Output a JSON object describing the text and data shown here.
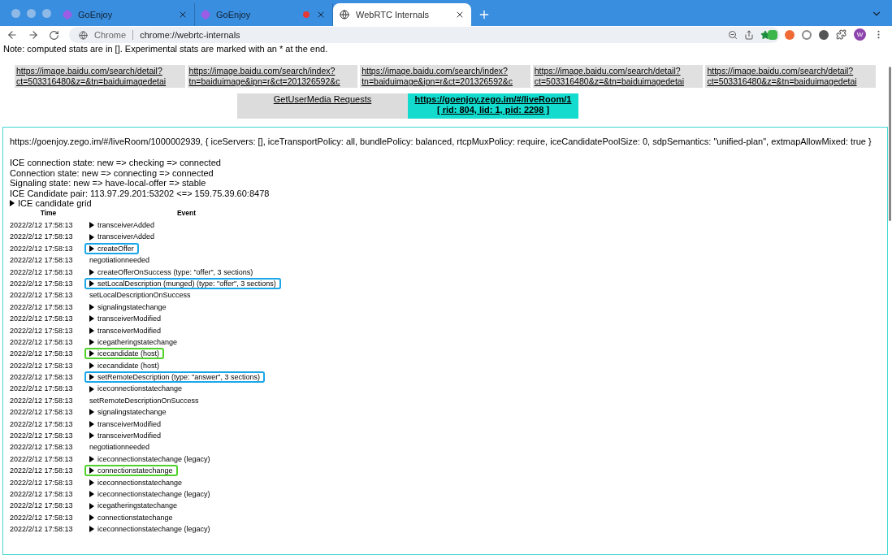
{
  "browser_tabs": [
    {
      "title": "GoEnjoy",
      "selected": false,
      "recording": false
    },
    {
      "title": "GoEnjoy",
      "selected": false,
      "recording": true
    },
    {
      "title": "WebRTC Internals",
      "selected": true,
      "recording": false
    }
  ],
  "address_bar": {
    "site_label": "Chrome",
    "url": "chrome://webrtc-internals"
  },
  "profile_initial": "W",
  "note": "Note: computed stats are in []. Experimental stats are marked with an * at the end.",
  "page_tabs_row1": [
    {
      "lines": [
        "https://image.baidu.com/search/detail?",
        "ct=503316480&z=&tn=baiduimagedetai"
      ]
    },
    {
      "lines": [
        "https://image.baidu.com/search/index?",
        "tn=baiduimage&ipn=r&ct=201326592&c"
      ]
    },
    {
      "lines": [
        "https://image.baidu.com/search/index?",
        "tn=baiduimage&ipn=r&ct=201326592&c"
      ]
    },
    {
      "lines": [
        "https://image.baidu.com/search/detail?",
        "ct=503316480&z=&tn=baiduimagedetai"
      ]
    },
    {
      "lines": [
        "https://image.baidu.com/search/detail?",
        "ct=503316480&z=&tn=baiduimagedetai"
      ]
    }
  ],
  "page_tabs_row2": [
    {
      "lines": [
        "GetUserMedia Requests"
      ],
      "selected": false
    },
    {
      "lines": [
        "https://goenjoy.zego.im/#/liveRoom/1",
        "[ rid: 804, lid: 1, pid: 2298 ]"
      ],
      "selected": true
    }
  ],
  "connection": {
    "config": "https://goenjoy.zego.im/#/liveRoom/1000002939, { iceServers: [], iceTransportPolicy: all, bundlePolicy: balanced, rtcpMuxPolicy: require, iceCandidatePoolSize: 0, sdpSemantics: \"unified-plan\", extmapAllowMixed: true }",
    "states": [
      "ICE connection state: new => checking => connected",
      "Connection state: new => connecting => connected",
      "Signaling state: new => have-local-offer => stable",
      "ICE Candidate pair: 113.97.29.201:53202 <=> 159.75.39.60:8478"
    ],
    "candidate_grid": {
      "label": "ICE candidate grid",
      "expanded": false
    }
  },
  "events_table": {
    "columns": [
      "Time",
      "Event"
    ],
    "rows": [
      {
        "time": "2022/2/12 17:58:13",
        "event": "transceiverAdded",
        "expandable": true,
        "outlined": false
      },
      {
        "time": "2022/2/12 17:58:13",
        "event": "transceiverAdded",
        "expandable": true,
        "outlined": false
      },
      {
        "time": "2022/2/12 17:58:13",
        "event": "createOffer",
        "expandable": true,
        "outlined": true,
        "color": "#1aa7e8"
      },
      {
        "time": "2022/2/12 17:58:13",
        "event": "negotiationneeded",
        "expandable": false,
        "outlined": false
      },
      {
        "time": "2022/2/12 17:58:13",
        "event": "createOfferOnSuccess (type: \"offer\", 3 sections)",
        "expandable": true,
        "outlined": false
      },
      {
        "time": "2022/2/12 17:58:13",
        "event": "setLocalDescription (munged) (type: \"offer\", 3 sections)",
        "expandable": true,
        "outlined": true,
        "color": "#1aa7e8"
      },
      {
        "time": "2022/2/12 17:58:13",
        "event": "setLocalDescriptionOnSuccess",
        "expandable": false,
        "outlined": false
      },
      {
        "time": "2022/2/12 17:58:13",
        "event": "signalingstatechange",
        "expandable": true,
        "outlined": false
      },
      {
        "time": "2022/2/12 17:58:13",
        "event": "transceiverModified",
        "expandable": true,
        "outlined": false
      },
      {
        "time": "2022/2/12 17:58:13",
        "event": "transceiverModified",
        "expandable": true,
        "outlined": false
      },
      {
        "time": "2022/2/12 17:58:13",
        "event": "icegatheringstatechange",
        "expandable": true,
        "outlined": false
      },
      {
        "time": "2022/2/12 17:58:13",
        "event": "icecandidate (host)",
        "expandable": true,
        "outlined": true,
        "color": "#4fd12a"
      },
      {
        "time": "2022/2/12 17:58:13",
        "event": "icecandidate (host)",
        "expandable": true,
        "outlined": false
      },
      {
        "time": "2022/2/12 17:58:13",
        "event": "setRemoteDescription (type: \"answer\", 3 sections)",
        "expandable": true,
        "outlined": true,
        "color": "#1aa7e8"
      },
      {
        "time": "2022/2/12 17:58:13",
        "event": "iceconnectionstatechange",
        "expandable": true,
        "outlined": false
      },
      {
        "time": "2022/2/12 17:58:13",
        "event": "setRemoteDescriptionOnSuccess",
        "expandable": false,
        "outlined": false
      },
      {
        "time": "2022/2/12 17:58:13",
        "event": "signalingstatechange",
        "expandable": true,
        "outlined": false
      },
      {
        "time": "2022/2/12 17:58:13",
        "event": "transceiverModified",
        "expandable": true,
        "outlined": false
      },
      {
        "time": "2022/2/12 17:58:13",
        "event": "transceiverModified",
        "expandable": true,
        "outlined": false
      },
      {
        "time": "2022/2/12 17:58:13",
        "event": "negotiationneeded",
        "expandable": false,
        "outlined": false
      },
      {
        "time": "2022/2/12 17:58:13",
        "event": "iceconnectionstatechange (legacy)",
        "expandable": true,
        "outlined": false
      },
      {
        "time": "2022/2/12 17:58:13",
        "event": "connectionstatechange",
        "expandable": true,
        "outlined": true,
        "color": "#4fd12a"
      },
      {
        "time": "2022/2/12 17:58:13",
        "event": "iceconnectionstatechange",
        "expandable": true,
        "outlined": false
      },
      {
        "time": "2022/2/12 17:58:13",
        "event": "iceconnectionstatechange (legacy)",
        "expandable": true,
        "outlined": false
      },
      {
        "time": "2022/2/12 17:58:13",
        "event": "icegatheringstatechange",
        "expandable": true,
        "outlined": false
      },
      {
        "time": "2022/2/12 17:58:13",
        "event": "connectionstatechange",
        "expandable": true,
        "outlined": false
      },
      {
        "time": "2022/2/12 17:58:13",
        "event": "iceconnectionstatechange (legacy)",
        "expandable": true,
        "outlined": false
      }
    ]
  }
}
